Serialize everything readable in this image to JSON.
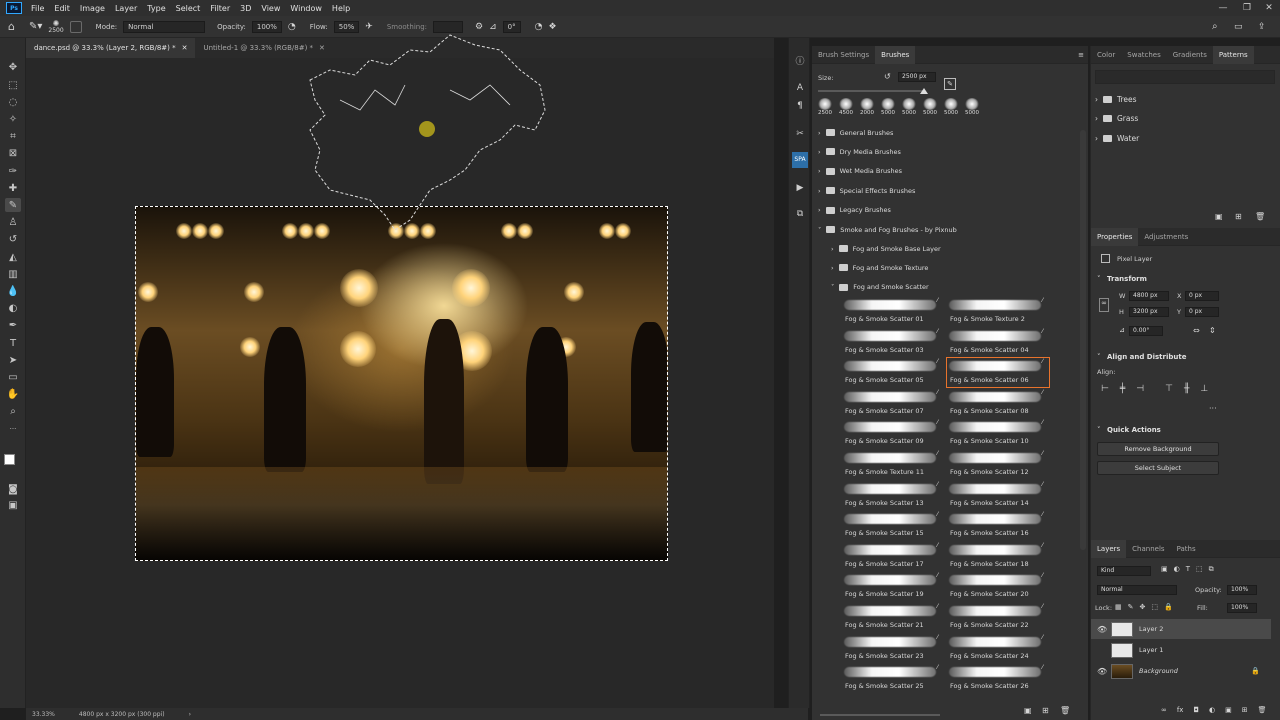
{
  "menu": {
    "items": [
      "File",
      "Edit",
      "Image",
      "Layer",
      "Type",
      "Select",
      "Filter",
      "3D",
      "View",
      "Window",
      "Help"
    ]
  },
  "options": {
    "brush_size": "2500",
    "mode_label": "Mode:",
    "mode_value": "Normal",
    "opacity_label": "Opacity:",
    "opacity_value": "100%",
    "flow_label": "Flow:",
    "flow_value": "50%",
    "smoothing_label": "Smoothing:",
    "angle_value": "0°"
  },
  "tabs": [
    {
      "label": "dance.psd @ 33.3% (Layer 2, RGB/8#) *"
    },
    {
      "label": "Untitled-1 @ 33.3% (RGB/8#) *"
    }
  ],
  "status": {
    "zoom": "33.33%",
    "doc_info": "4800 px x 3200 px (300 ppi)"
  },
  "brush_panel": {
    "tabs": [
      "Brush Settings",
      "Brushes"
    ],
    "size_label": "Size:",
    "size_value": "2500 px",
    "presets": [
      "2500",
      "4500",
      "2000",
      "5000",
      "5000",
      "5000",
      "5000",
      "5000"
    ],
    "folders": [
      "General Brushes",
      "Dry Media Brushes",
      "Wet Media Brushes",
      "Special Effects Brushes",
      "Legacy Brushes",
      "Smoke and Fog Brushes - by Pixnub"
    ],
    "subfolders": [
      "Fog and Smoke Base Layer",
      "Fog and Smoke Texture",
      "Fog and Smoke Scatter"
    ],
    "brushes": [
      "Fog & Smoke Scatter 01",
      "Fog & Smoke Texture 2",
      "Fog & Smoke Scatter 03",
      "Fog & Smoke Scatter 04",
      "Fog & Smoke Scatter 05",
      "Fog & Smoke Scatter 06",
      "Fog & Smoke Scatter 07",
      "Fog & Smoke Scatter 08",
      "Fog & Smoke Scatter 09",
      "Fog & Smoke Scatter 10",
      "Fog & Smoke Texture 11",
      "Fog & Smoke Scatter 12",
      "Fog & Smoke Scatter 13",
      "Fog & Smoke Scatter 14",
      "Fog & Smoke Scatter 15",
      "Fog & Smoke Scatter 16",
      "Fog & Smoke Scatter 17",
      "Fog & Smoke Scatter 18",
      "Fog & Smoke Scatter 19",
      "Fog & Smoke Scatter 20",
      "Fog & Smoke Scatter 21",
      "Fog & Smoke Scatter 22",
      "Fog & Smoke Scatter 23",
      "Fog & Smoke Scatter 24",
      "Fog & Smoke Scatter 25",
      "Fog & Smoke Scatter 26"
    ],
    "selected_brush": "Fog & Smoke Scatter 06"
  },
  "patterns_panel": {
    "tabs": [
      "Color",
      "Swatches",
      "Gradients",
      "Patterns"
    ],
    "groups": [
      "Trees",
      "Grass",
      "Water"
    ]
  },
  "properties": {
    "tabs": [
      "Properties",
      "Adjustments"
    ],
    "layer_type": "Pixel Layer",
    "transform_title": "Transform",
    "w_label": "W",
    "w_value": "4800 px",
    "h_label": "H",
    "h_value": "3200 px",
    "x_label": "X",
    "x_value": "0 px",
    "y_label": "Y",
    "y_value": "0 px",
    "angle_value": "0.00°",
    "align_title": "Align and Distribute",
    "align_label": "Align:",
    "quick_title": "Quick Actions",
    "remove_bg": "Remove Background",
    "select_subject": "Select Subject"
  },
  "layers_panel": {
    "tabs": [
      "Layers",
      "Channels",
      "Paths"
    ],
    "kind": "Kind",
    "blend": "Normal",
    "opacity_label": "Opacity:",
    "opacity_value": "100%",
    "lock_label": "Lock:",
    "fill_label": "Fill:",
    "fill_value": "100%",
    "layers": [
      {
        "name": "Layer 2",
        "visible": true,
        "active": true
      },
      {
        "name": "Layer 1",
        "visible": false,
        "active": false
      },
      {
        "name": "Background",
        "visible": true,
        "active": false
      }
    ]
  }
}
